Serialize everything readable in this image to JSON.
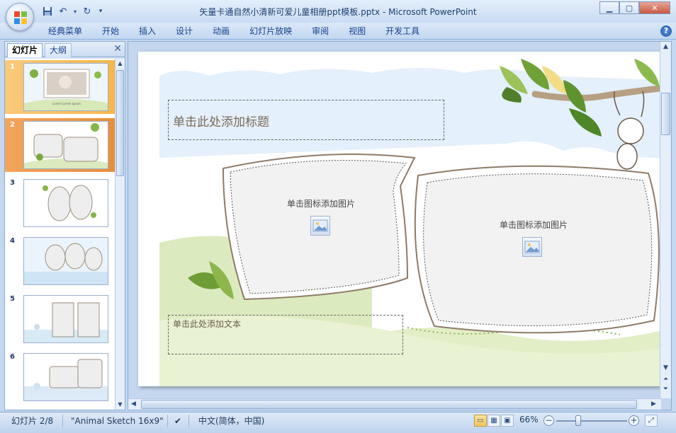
{
  "window": {
    "title": "矢量卡通自然小清新可爱儿童相册ppt模板.pptx - Microsoft PowerPoint"
  },
  "qat": {
    "save": "save-icon",
    "undo": "undo-icon",
    "redo": "redo-icon",
    "customize": "customize-icon"
  },
  "ribbon": {
    "tabs": [
      "经典菜单",
      "开始",
      "插入",
      "设计",
      "动画",
      "幻灯片放映",
      "审阅",
      "视图",
      "开发工具"
    ],
    "help": "?"
  },
  "panel": {
    "tab_slides": "幻灯片",
    "tab_outline": "大纲",
    "close": "✕"
  },
  "thumbnails": [
    "1",
    "2",
    "3",
    "4",
    "5",
    "6"
  ],
  "slide": {
    "title_placeholder": "单击此处添加标题",
    "pic_placeholder_left": "单击图标添加图片",
    "pic_placeholder_right": "单击图标添加图片",
    "text_placeholder": "单击此处添加文本",
    "thumb1_caption": "Lorem Lorem ipsum"
  },
  "status": {
    "slide_counter": "幻灯片 2/8",
    "theme": "\"Animal Sketch 16x9\"",
    "language": "中文(简体，中国)",
    "zoom": "66%"
  },
  "colors": {
    "accent": "#15428b",
    "selected_thumb": "#f4a45a",
    "grass": "#d4e6b0",
    "sky": "#dcecfb"
  }
}
